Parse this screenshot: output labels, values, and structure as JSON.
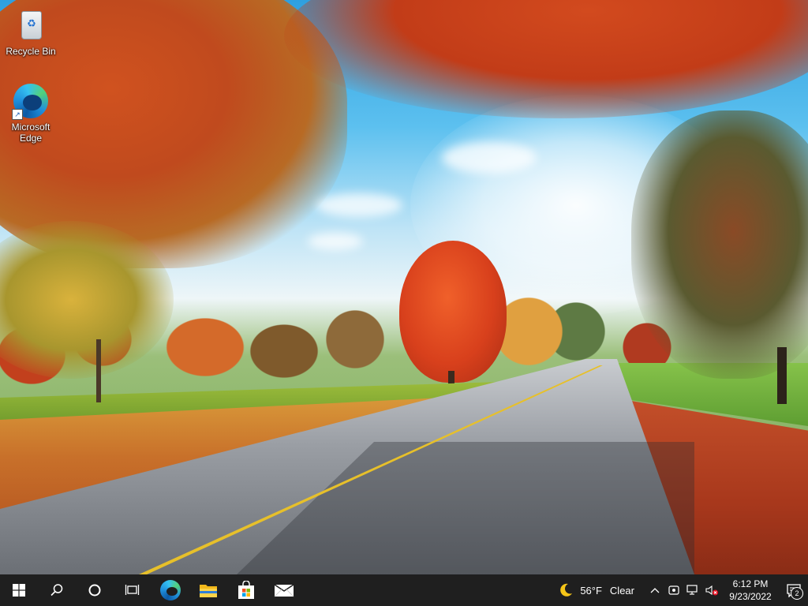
{
  "desktop": {
    "icons": [
      {
        "label": "Recycle Bin",
        "icon": "recycle-bin-icon"
      },
      {
        "label": "Microsoft Edge",
        "icon": "edge-icon"
      }
    ]
  },
  "taskbar": {
    "pinned": [
      {
        "name": "start",
        "icon": "windows-logo-icon"
      },
      {
        "name": "search",
        "icon": "search-icon"
      },
      {
        "name": "cortana",
        "icon": "cortana-circle-icon"
      },
      {
        "name": "task-view",
        "icon": "task-view-icon"
      },
      {
        "name": "edge",
        "icon": "edge-icon"
      },
      {
        "name": "file-explorer",
        "icon": "folder-icon"
      },
      {
        "name": "store",
        "icon": "store-bag-icon"
      },
      {
        "name": "mail",
        "icon": "mail-icon"
      }
    ],
    "weather": {
      "icon": "moon-icon",
      "temperature": "56°F",
      "condition": "Clear"
    },
    "tray_icons": [
      "chevron-up-icon",
      "meet-now-icon",
      "network-icon",
      "volume-muted-icon"
    ],
    "clock": {
      "time": "6:12 PM",
      "date": "9/23/2022"
    },
    "notifications": {
      "count": "2",
      "icon": "action-center-icon"
    }
  },
  "colors": {
    "taskbar": "#1f1f1f",
    "accent_edge": "#1f8fdc"
  }
}
